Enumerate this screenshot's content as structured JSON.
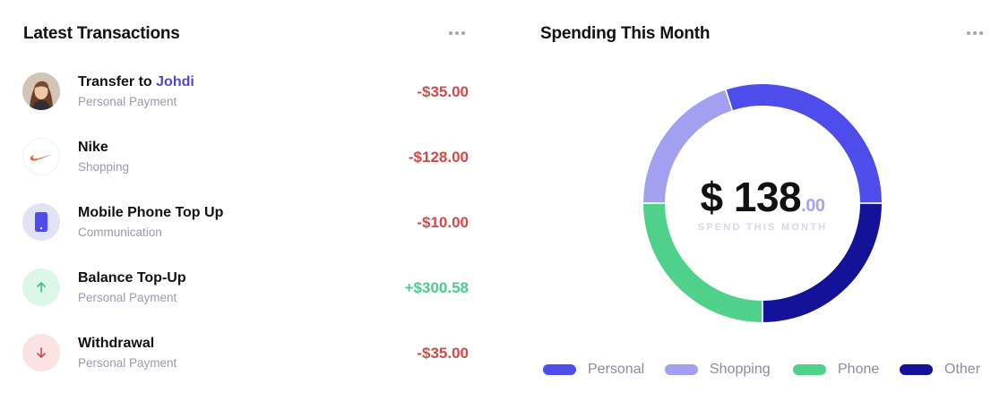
{
  "transactions_panel": {
    "title": "Latest Transactions",
    "more_icon": "more-horizontal-icon",
    "items": [
      {
        "icon": "avatar-photo",
        "name_prefix": "Transfer to ",
        "name_highlight": "Johdi",
        "category": "Personal Payment",
        "amount": "-$35.00",
        "type": "debit"
      },
      {
        "icon": "nike-logo-icon",
        "name_prefix": "Nike",
        "name_highlight": "",
        "category": "Shopping",
        "amount": "-$128.00",
        "type": "debit"
      },
      {
        "icon": "phone-icon",
        "name_prefix": "Mobile Phone Top Up",
        "name_highlight": "",
        "category": "Communication",
        "amount": "-$10.00",
        "type": "debit"
      },
      {
        "icon": "arrow-up-icon",
        "name_prefix": "Balance Top-Up",
        "name_highlight": "",
        "category": "Personal Payment",
        "amount": "+$300.58",
        "type": "credit"
      },
      {
        "icon": "arrow-down-icon",
        "name_prefix": "Withdrawal",
        "name_highlight": "",
        "category": "Personal Payment",
        "amount": "-$35.00",
        "type": "debit"
      }
    ]
  },
  "spending_panel": {
    "title": "Spending This Month",
    "more_icon": "more-horizontal-icon",
    "total_main": "$ 138",
    "total_cents": ".00",
    "total_caption": "SPEND THIS MONTH"
  },
  "chart_data": {
    "type": "pie",
    "donut": true,
    "categories": [
      "Personal",
      "Shopping",
      "Phone",
      "Other"
    ],
    "values": [
      30,
      20,
      25,
      25
    ],
    "colors": [
      "#4f4cec",
      "#a3a0f2",
      "#4fd18b",
      "#15129a"
    ],
    "legend_placement": "bottom"
  },
  "colors": {
    "accent": "#4f46e5",
    "debit": "#d04a4a",
    "credit": "#4ecb8c",
    "muted_text": "#9a9ab0"
  }
}
